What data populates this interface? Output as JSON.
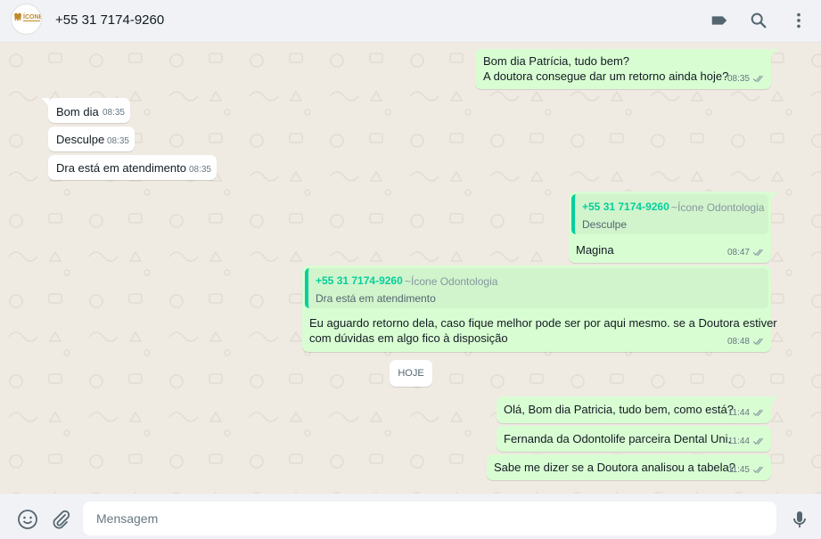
{
  "header": {
    "contact": "+55 31 7174-9260",
    "avatar_text": "ÍCONE",
    "icons": [
      "label-icon",
      "search-icon",
      "menu-dots-icon"
    ]
  },
  "messages": [
    {
      "dir": "out",
      "lines": [
        "Bom dia Patrícia, tudo bem?",
        "A doutora consegue dar um retorno ainda hoje?"
      ],
      "time": "08:35",
      "ticks": true
    },
    {
      "dir": "in",
      "lines": [
        "Bom dia"
      ],
      "time": "08:35"
    },
    {
      "dir": "in",
      "lines": [
        "Desculpe"
      ],
      "time": "08:35"
    },
    {
      "dir": "in",
      "lines": [
        "Dra está em atendimento"
      ],
      "time": "08:35"
    },
    {
      "dir": "out",
      "quote": {
        "author": "+55 31 7174-9260",
        "subname": "~Ícone Odontologia",
        "text": "Desculpe"
      },
      "lines": [
        "Magina"
      ],
      "time": "08:47",
      "ticks": true
    },
    {
      "dir": "out",
      "quote": {
        "author": "+55 31 7174-9260",
        "subname": "~Ícone Odontologia",
        "text": "Dra está em atendimento"
      },
      "lines": [
        "Eu aguardo retorno dela, caso fique melhor pode ser por aqui mesmo. se a Doutora estiver",
        "com dúvidas em algo fico à disposição"
      ],
      "time": "08:48",
      "ticks": true
    },
    {
      "dir": "out",
      "lines": [
        "Olá, Bom dia Patricia, tudo bem, como está?"
      ],
      "time": "11:44",
      "ticks": true
    },
    {
      "dir": "out",
      "lines": [
        "Fernanda da Odontolife parceira Dental Uni."
      ],
      "time": "11:44",
      "ticks": true
    },
    {
      "dir": "out",
      "lines": [
        "Sabe me dizer se a Doutora analisou a tabela?"
      ],
      "time": "11:45",
      "ticks": true
    }
  ],
  "day_divider": "HOJE",
  "composer": {
    "placeholder": "Mensagem",
    "icons": [
      "emoji-icon",
      "attach-icon",
      "mic-icon"
    ]
  },
  "colors": {
    "outgoing_bubble": "#d9fdd3",
    "incoming_bubble": "#ffffff",
    "chat_background": "#efeae2",
    "quote_accent": "#06cf9c",
    "read_tick": "#8696a0"
  }
}
